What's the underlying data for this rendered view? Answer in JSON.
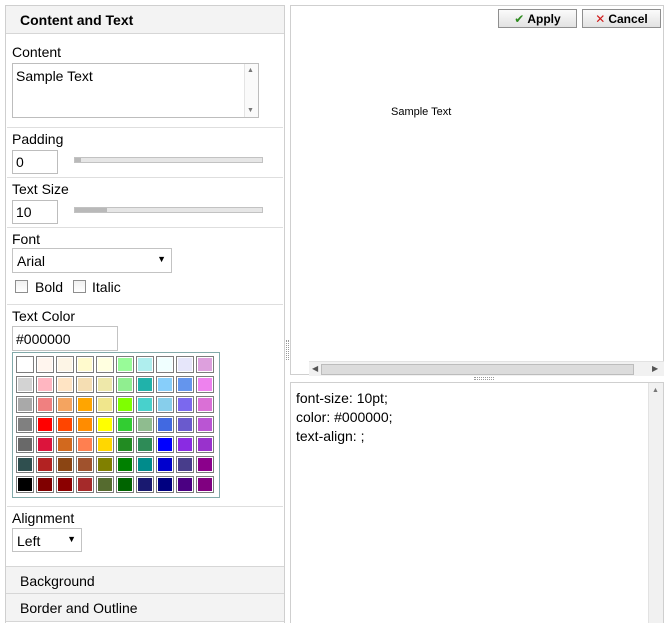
{
  "sections": {
    "content_text": "Content and Text",
    "background": "Background",
    "border": "Border and Outline"
  },
  "labels": {
    "content": "Content",
    "padding": "Padding",
    "text_size": "Text Size",
    "font": "Font",
    "bold": "Bold",
    "italic": "Italic",
    "text_color": "Text Color",
    "alignment": "Alignment"
  },
  "values": {
    "content": "Sample Text",
    "padding": "0",
    "padding_level": 0.03,
    "text_size": "10",
    "text_size_level": 0.17,
    "font": "Arial",
    "bold": false,
    "italic": false,
    "text_color": "#000000",
    "alignment": "Left"
  },
  "palette": [
    [
      "#ffffff",
      "#fff5ee",
      "#fdf5e6",
      "#fffacd",
      "#ffffe0",
      "#98fb98",
      "#afeeee",
      "#f0ffff",
      "#e6e6fa",
      "#dda0dd"
    ],
    [
      "#d3d3d3",
      "#ffb6c1",
      "#ffe4c4",
      "#f5deb3",
      "#eee8aa",
      "#90ee90",
      "#20b2aa",
      "#87cefa",
      "#6495ed",
      "#ee82ee"
    ],
    [
      "#a9a9a9",
      "#f08080",
      "#f4a460",
      "#ffa500",
      "#f0e68c",
      "#7fff00",
      "#48d1cc",
      "#87ceeb",
      "#7b68ee",
      "#da70d6"
    ],
    [
      "#808080",
      "#ff0000",
      "#ff4500",
      "#ff8c00",
      "#ffff00",
      "#32cd32",
      "#8fbc8f",
      "#4169e1",
      "#6a5acd",
      "#ba55d3"
    ],
    [
      "#696969",
      "#dc143c",
      "#d2691e",
      "#ff7f50",
      "#ffd700",
      "#228b22",
      "#2e8b57",
      "#0000ff",
      "#8a2be2",
      "#9932cc"
    ],
    [
      "#2f4f4f",
      "#b22222",
      "#8b4513",
      "#a0522d",
      "#808000",
      "#008000",
      "#008b8b",
      "#0000cd",
      "#483d8b",
      "#8b008b"
    ],
    [
      "#000000",
      "#800000",
      "#8b0000",
      "#a52a2a",
      "#556b2f",
      "#006400",
      "#191970",
      "#000080",
      "#4b0082",
      "#800080"
    ]
  ],
  "toolbar": {
    "apply_label": "Apply",
    "apply_icon": "check-icon",
    "cancel_label": "Cancel",
    "cancel_icon": "x-icon"
  },
  "preview": {
    "text": "Sample Text"
  },
  "css_output": [
    "font-size: 10pt;",
    "color: #000000;",
    "text-align: ;"
  ],
  "colors": {
    "header_bg": "#f3f3f3",
    "border": "#cfcfcf",
    "apply_icon": "#2e8b1f",
    "cancel_icon": "#d01a1a"
  }
}
